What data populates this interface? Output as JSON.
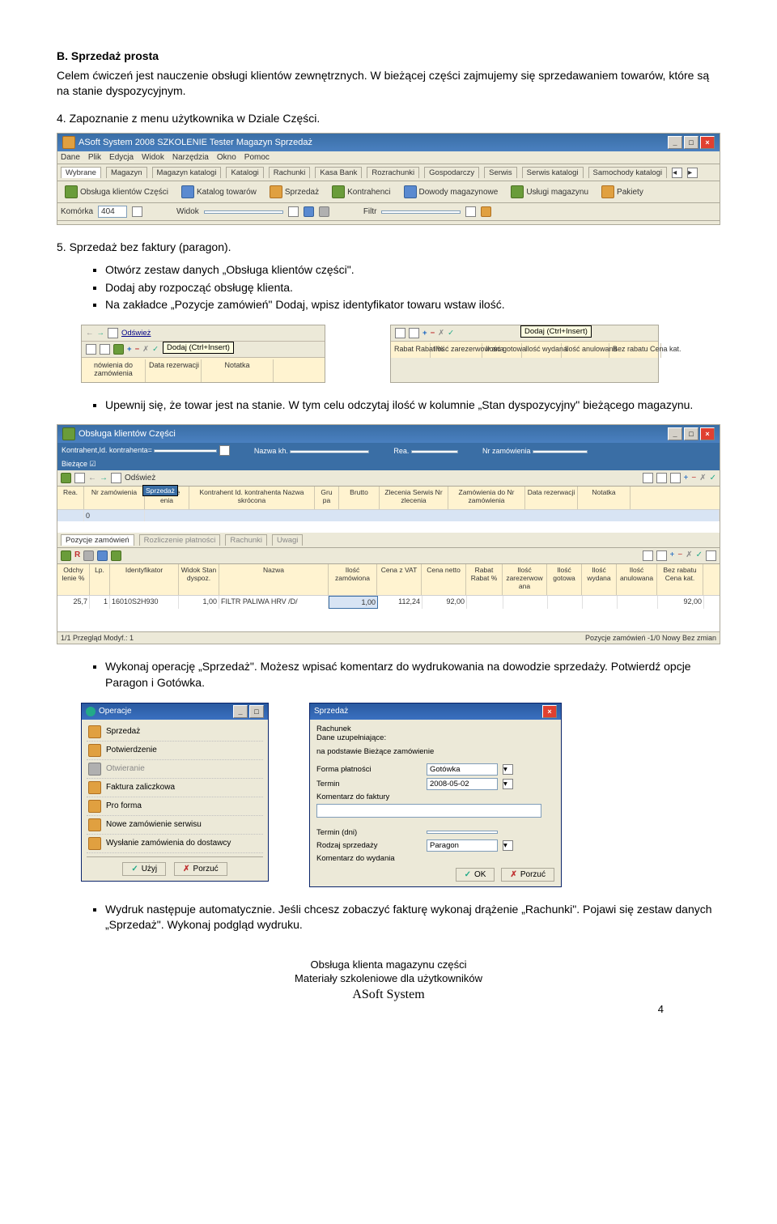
{
  "heading": "B. Sprzedaż prosta",
  "intro": "Celem ćwiczeń jest nauczenie obsługi klientów zewnętrznych. W bieżącej części zajmujemy się sprzedawaniem towarów, które są na stanie dyspozycyjnym.",
  "step4": "4. Zapoznanie z menu użytkownika w Dziale Części.",
  "win1": {
    "title": "ASoft System 2008   SZKOLENIE   Tester Magazyn Sprzedaż",
    "menubar": [
      "Dane",
      "Plik",
      "Edycja",
      "Widok",
      "Narzędzia",
      "Okno",
      "Pomoc"
    ],
    "tabs": [
      "Wybrane",
      "Magazyn",
      "Magazyn katalogi",
      "Katalogi",
      "Rachunki",
      "Kasa Bank",
      "Rozrachunki",
      "Gospodarczy",
      "Serwis",
      "Serwis katalogi",
      "Samochody katalogi"
    ],
    "toolbar2": [
      "Obsługa klientów Części",
      "Katalog towarów",
      "Sprzedaż",
      "Kontrahenci",
      "Dowody magazynowe",
      "Usługi magazynu",
      "Pakiety"
    ],
    "filters": {
      "komorka_lbl": "Komórka",
      "komorka_val": "404",
      "widok_lbl": "Widok",
      "filtr_lbl": "Filtr"
    }
  },
  "step5": {
    "title": "5. Sprzedaż bez faktury (paragon).",
    "bullets": [
      "Otwórz zestaw danych „Obsługa klientów części\".",
      "Dodaj aby rozpocząć obsługę klienta.",
      "Na zakładce „Pozycje zamówień\" Dodaj, wpisz identyfikator towaru wstaw ilość."
    ]
  },
  "snippet1": {
    "refresh": "Odśwież",
    "tooltip": "Dodaj (Ctrl+Insert)",
    "headers": [
      "nówienia do",
      "zamówienia",
      "Data rezerwacji",
      "Notatka"
    ]
  },
  "snippet2": {
    "tooltip": "Dodaj (Ctrl+Insert)",
    "headers": [
      "Rabat Rabat %",
      "Ilość zarezerwow ana",
      "Ilość gotowa",
      "Ilość wydana",
      "Ilość anulowana",
      "Bez rabatu Cena kat."
    ]
  },
  "bullet_upewnij": "Upewnij się, że towar jest na stanie. W tym celu odczytaj ilość w kolumnie „Stan dyspozycyjny\" bieżącego magazynu.",
  "win2": {
    "title": "Obsługa klientów Części",
    "top_lbls": {
      "kontrahent": "Kontrahent,Id. kontrahenta=",
      "nazwa": "Nazwa kh.",
      "rea": "Rea.",
      "nr": "Nr zamówienia"
    },
    "biezace": "Bieżące ☑",
    "refresh": "Odśwież",
    "tab_sel": "Sprzedaż",
    "cols1": [
      "Rea.",
      "Nr zamówienia",
      "Wysłane enia",
      "Kontrahent Id. kontrahenta  Nazwa skrócona",
      "Gru pa",
      "Brutto",
      "Zlecenia Serwis Nr zlecenia",
      "Zamówienia do Nr zamówienia",
      "Data rezerwacji",
      "Notatka"
    ],
    "row1_first": "0",
    "tabs2": [
      "Pozycje zamówień",
      "Rozliczenie płatności",
      "Rachunki",
      "Uwagi"
    ],
    "cols2": [
      "Odchy lenie %",
      "Lp.",
      "Identyfikator",
      "Widok Stan dyspoz.",
      "Nazwa",
      "Ilość zamówiona",
      "Cena z VAT",
      "Cena netto",
      "Rabat Rabat %",
      "Ilość zarezerwow ana",
      "Ilość gotowa",
      "Ilość wydana",
      "Ilość anulowana",
      "Bez rabatu Cena kat."
    ],
    "row2": {
      "odch": "25,7",
      "lp": "1",
      "ident": "16010S2H930",
      "stan": "1,00",
      "nazwa": "FILTR PALIWA HRV /D/",
      "ilosc": "1,00",
      "cvat": "112,24",
      "cnetto": "92,00",
      "cenakat": "92,00"
    },
    "status": {
      "left": "1/1   Przegląd  Modyf.: 1",
      "right": "Pozycje zamówień      -1/0     Nowy     Bez zmian"
    }
  },
  "bullet_wykonaj": "Wykonaj operację „Sprzedaż\". Możesz wpisać komentarz do wydrukowania na dowodzie sprzedaży. Potwierdź opcje Paragon i Gotówka.",
  "dlg_ops": {
    "title": "Operacje",
    "items": [
      {
        "label": "Sprzedaż",
        "disabled": false
      },
      {
        "label": "Potwierdzenie",
        "disabled": false
      },
      {
        "label": "Otwieranie",
        "disabled": true
      },
      {
        "label": "Faktura zaliczkowa",
        "disabled": false
      },
      {
        "label": "Pro forma",
        "disabled": false
      },
      {
        "label": "Nowe zamówienie serwisu",
        "disabled": false
      },
      {
        "label": "Wysłanie zamówienia do dostawcy",
        "disabled": false
      }
    ],
    "uzyj": "Użyj",
    "porzuc": "Porzuć"
  },
  "dlg_sp": {
    "title": "Sprzedaż",
    "lines": [
      "Rachunek",
      "Dane uzupełniające:",
      "na podstawie Bieżące zamówienie"
    ],
    "rows": [
      {
        "lbl": "Forma płatności",
        "val": "Gotówka"
      },
      {
        "lbl": "Termin",
        "val": "2008-05-02"
      },
      {
        "lbl": "Komentarz do faktury",
        "val": ""
      }
    ],
    "rows2": [
      {
        "lbl": "Termin (dni)",
        "val": ""
      },
      {
        "lbl": "Rodzaj sprzedaży",
        "val": "Paragon"
      },
      {
        "lbl": "Komentarz do wydania",
        "val": ""
      }
    ],
    "ok": "OK",
    "porzuc": "Porzuć"
  },
  "bullet_wydruk": "Wydruk następuje automatycznie. Jeśli chcesz zobaczyć fakturę wykonaj drążenie „Rachunki\". Pojawi się zestaw danych „Sprzedaż\". Wykonaj podgląd wydruku.",
  "footer": {
    "l1": "Obsługa klienta magazynu części",
    "l2": "Materiały szkoleniowe dla użytkowników",
    "l3": "ASoft System",
    "page": "4"
  }
}
